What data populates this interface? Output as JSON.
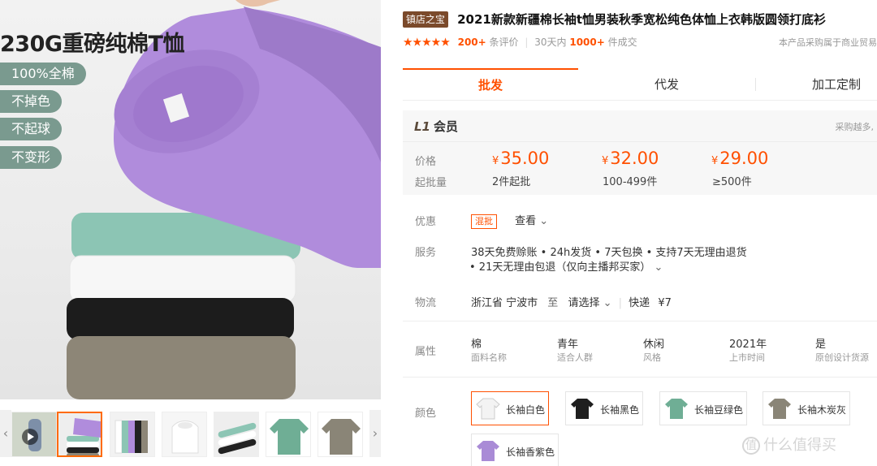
{
  "gallery": {
    "title": "230G重磅纯棉T恤",
    "features": [
      "100%全棉",
      "不掉色",
      "不起球",
      "不变形"
    ],
    "thumb_prev": "‹",
    "thumb_next": "›"
  },
  "product": {
    "store_badge": "镇店之宝",
    "title": "2021新款新疆棉长袖t恤男装秋季宽松纯色体恤上衣韩版圆领打底衫",
    "reviews_count": "200+",
    "reviews_label": "条评价",
    "sales_period": "30天内",
    "sales_count": "1000+",
    "sales_label": "件成交",
    "note": "本产品采购属于商业贸易"
  },
  "tabs": [
    "批发",
    "代发",
    "加工定制"
  ],
  "pricing": {
    "member_level": "L1",
    "member_label": "会员",
    "member_note": "采购越多,",
    "price_label": "价格",
    "moq_label": "起批量",
    "currency": "¥",
    "tiers": [
      {
        "price": "35.00",
        "qty": "2件起批"
      },
      {
        "price": "32.00",
        "qty": "100-499件"
      },
      {
        "price": "29.00",
        "qty": "≥500件"
      }
    ]
  },
  "promo": {
    "label": "优惠",
    "badge": "混批",
    "link": "查看"
  },
  "service": {
    "label": "服务",
    "line1": "38天免费赊账 • 24h发货 • 7天包换 • 支持7天无理由退货",
    "line2": "• 21天无理由包退（仅向主播邦买家）"
  },
  "logistics": {
    "label": "物流",
    "from": "浙江省 宁波市",
    "to_word": "至",
    "select": "请选择",
    "express": "快递",
    "fee": "¥7"
  },
  "attributes": {
    "label": "属性",
    "items": [
      {
        "value": "棉",
        "key": "面料名称"
      },
      {
        "value": "青年",
        "key": "适合人群"
      },
      {
        "value": "休闲",
        "key": "风格"
      },
      {
        "value": "2021年",
        "key": "上市时间"
      },
      {
        "value": "是",
        "key": "原创设计货源"
      }
    ]
  },
  "colors": {
    "label": "颜色",
    "options": [
      {
        "name": "长袖白色",
        "hex": "#f3f3f3",
        "selected": true
      },
      {
        "name": "长袖黑色",
        "hex": "#1e1e1e",
        "selected": false
      },
      {
        "name": "长袖豆绿色",
        "hex": "#6fae95",
        "selected": false
      },
      {
        "name": "长袖木炭灰",
        "hex": "#8a8577",
        "selected": false
      },
      {
        "name": "长袖香紫色",
        "hex": "#a98bd6",
        "selected": false
      }
    ]
  },
  "watermark": "什么值得买"
}
